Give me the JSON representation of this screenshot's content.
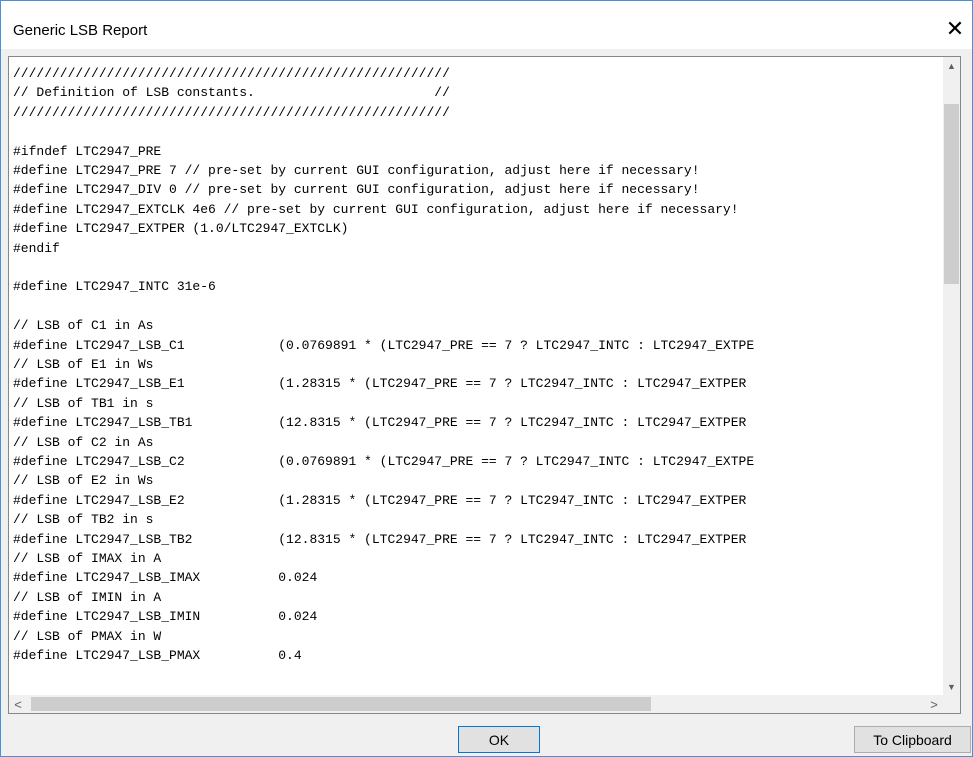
{
  "window": {
    "title": "Generic LSB Report",
    "close_glyph": "✕"
  },
  "code_lines": [
    "////////////////////////////////////////////////////////",
    "// Definition of LSB constants.                       //",
    "////////////////////////////////////////////////////////",
    "",
    "#ifndef LTC2947_PRE",
    "#define LTC2947_PRE 7 // pre-set by current GUI configuration, adjust here if necessary!",
    "#define LTC2947_DIV 0 // pre-set by current GUI configuration, adjust here if necessary!",
    "#define LTC2947_EXTCLK 4e6 // pre-set by current GUI configuration, adjust here if necessary!",
    "#define LTC2947_EXTPER (1.0/LTC2947_EXTCLK)",
    "#endif",
    "",
    "#define LTC2947_INTC 31e-6",
    "",
    "// LSB of C1 in As",
    "#define LTC2947_LSB_C1            (0.0769891 * (LTC2947_PRE == 7 ? LTC2947_INTC : LTC2947_EXTPE",
    "// LSB of E1 in Ws",
    "#define LTC2947_LSB_E1            (1.28315 * (LTC2947_PRE == 7 ? LTC2947_INTC : LTC2947_EXTPER",
    "// LSB of TB1 in s",
    "#define LTC2947_LSB_TB1           (12.8315 * (LTC2947_PRE == 7 ? LTC2947_INTC : LTC2947_EXTPER",
    "// LSB of C2 in As",
    "#define LTC2947_LSB_C2            (0.0769891 * (LTC2947_PRE == 7 ? LTC2947_INTC : LTC2947_EXTPE",
    "// LSB of E2 in Ws",
    "#define LTC2947_LSB_E2            (1.28315 * (LTC2947_PRE == 7 ? LTC2947_INTC : LTC2947_EXTPER",
    "// LSB of TB2 in s",
    "#define LTC2947_LSB_TB2           (12.8315 * (LTC2947_PRE == 7 ? LTC2947_INTC : LTC2947_EXTPER",
    "// LSB of IMAX in A",
    "#define LTC2947_LSB_IMAX          0.024",
    "// LSB of IMIN in A",
    "#define LTC2947_LSB_IMIN          0.024",
    "// LSB of PMAX in W",
    "#define LTC2947_LSB_PMAX          0.4"
  ],
  "scroll": {
    "up_glyph": "▲",
    "down_glyph": "▼",
    "left_glyph": "<",
    "right_glyph": ">"
  },
  "buttons": {
    "ok_label": "OK",
    "clipboard_label": "To Clipboard"
  }
}
